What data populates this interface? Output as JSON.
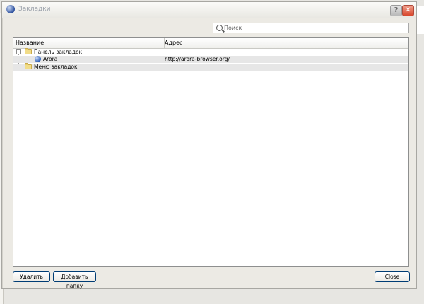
{
  "window": {
    "title": "Закладки"
  },
  "search": {
    "placeholder": "Поиск",
    "value": ""
  },
  "columns": {
    "name": "Название",
    "address": "Адрес"
  },
  "tree": {
    "toolbar_folder": "Панель закладок",
    "bookmark": {
      "name": "Arora",
      "url": "http://arora-browser.org/"
    },
    "menu_folder": "Меню закладок"
  },
  "buttons": {
    "delete": "Удалить",
    "add_folder": "Добавить папку",
    "close": "Close"
  },
  "icons": {
    "title": "arora-globe-icon",
    "search": "search-icon",
    "folder": "folder-icon",
    "bookmark": "globe-icon"
  }
}
